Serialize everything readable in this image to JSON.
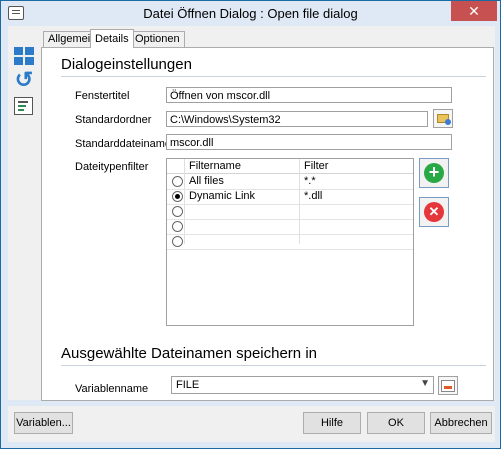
{
  "window": {
    "title": "Datei Öffnen Dialog : Open file dialog",
    "close_glyph": "✕"
  },
  "sidebar": {
    "icons": [
      "grid-icon",
      "refresh-icon",
      "form-icon"
    ]
  },
  "tabs": [
    {
      "label": "Allgemein",
      "active": false
    },
    {
      "label": "Details",
      "active": true
    },
    {
      "label": "Optionen",
      "active": false
    }
  ],
  "section1": {
    "title": "Dialogeinstellungen"
  },
  "fields": {
    "fenstertitel": {
      "label": "Fenstertitel",
      "value": "Öffnen von mscor.dll"
    },
    "standardordner": {
      "label": "Standardordner",
      "value": "C:\\Windows\\System32"
    },
    "standarddateiname": {
      "label": "Standarddateiname",
      "value": "mscor.dll"
    },
    "dateitypenfilter": {
      "label": "Dateitypenfilter"
    }
  },
  "filter_table": {
    "columns": [
      "Filtername",
      "Filter"
    ],
    "rows": [
      {
        "name": "All files",
        "filter": "*.*",
        "selected": false
      },
      {
        "name": "Dynamic Link",
        "filter": "*.dll",
        "selected": true
      },
      {
        "name": "",
        "filter": "",
        "selected": false
      },
      {
        "name": "",
        "filter": "",
        "selected": false
      },
      {
        "name": "",
        "filter": "",
        "selected": false
      }
    ]
  },
  "section2": {
    "title": "Ausgewählte Dateinamen speichern in"
  },
  "variable": {
    "label": "Variablenname",
    "value": "FILE"
  },
  "footer": {
    "variables_label": "Variablen...",
    "help_label": "Hilfe",
    "ok_label": "OK",
    "cancel_label": "Abbrechen"
  },
  "colors": {
    "accent": "#2b7bc8",
    "add": "#29a846",
    "remove": "#e5363b",
    "close": "#c75050"
  }
}
